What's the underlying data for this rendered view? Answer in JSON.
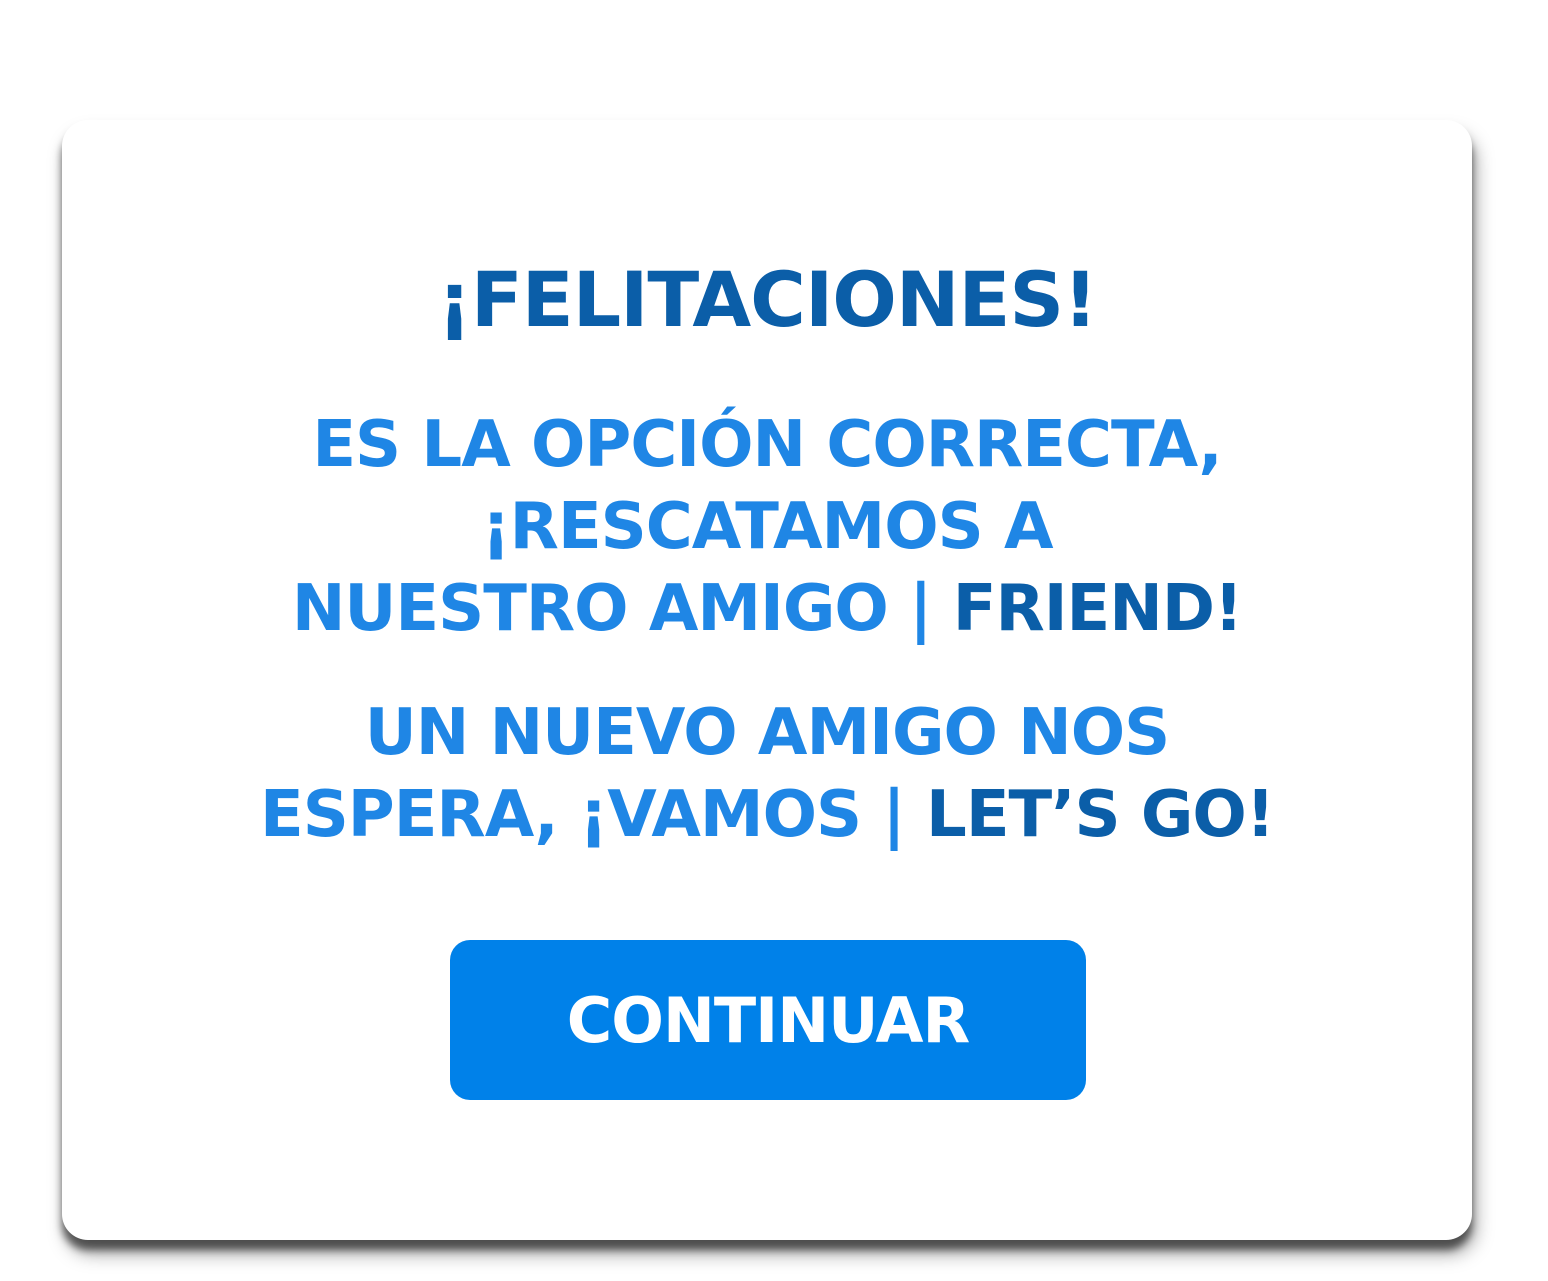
{
  "dialog": {
    "title": "¡FELITACIONES!",
    "message1": {
      "line1": "ES LA OPCIÓN CORRECTA,",
      "line2": "¡RESCATAMOS A",
      "line3_a": "NUESTRO AMIGO |",
      "line3_b": "FRIEND!"
    },
    "message2": {
      "line1": "UN NUEVO AMIGO NOS",
      "line2_a": "ESPERA, ¡VAMOS |",
      "line2_b": "LET’S GO!"
    },
    "continue_label": "CONTINUAR"
  },
  "colors": {
    "dark_blue": "#0b5ea8",
    "light_blue": "#1f86e5",
    "button": "#0081e9",
    "button_text": "#ffffff"
  }
}
